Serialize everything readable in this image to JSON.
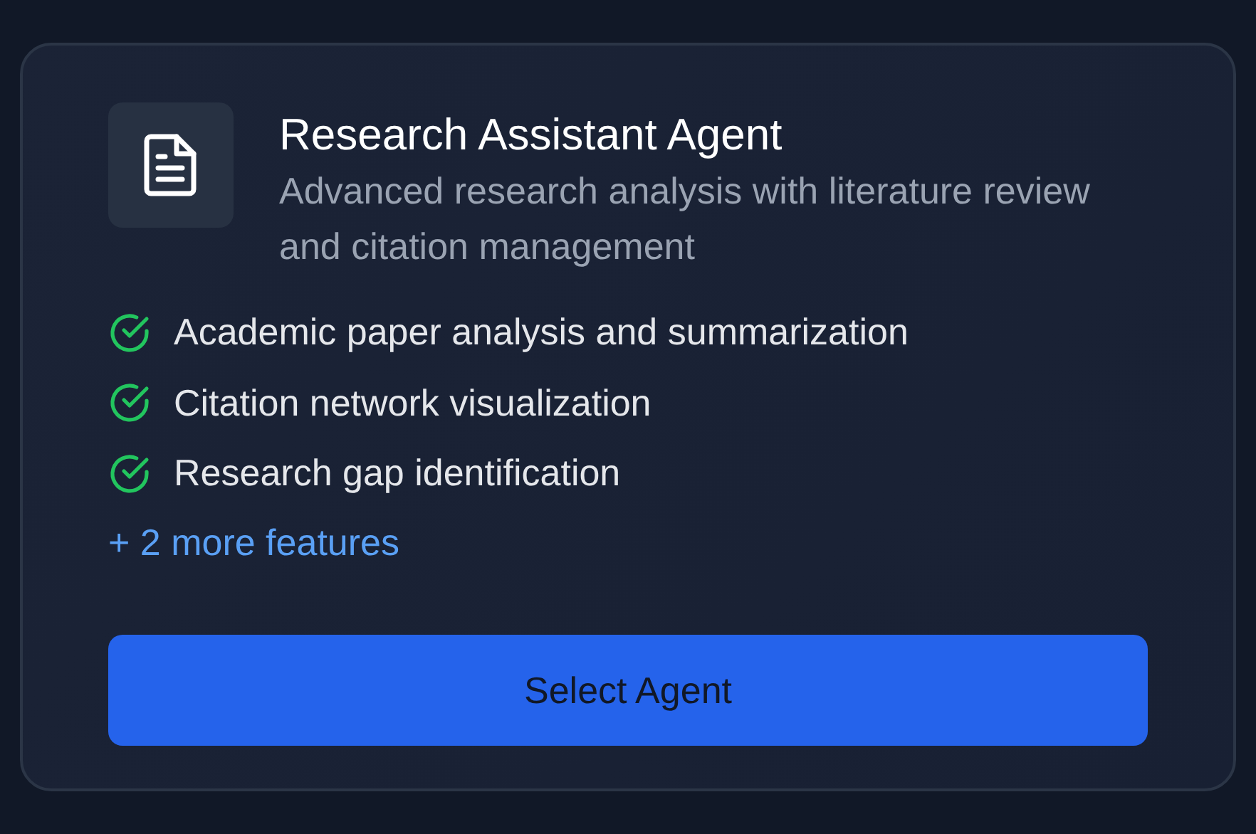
{
  "card": {
    "title": "Research Assistant Agent",
    "description": "Advanced research analysis with literature review and citation management",
    "features": [
      {
        "label": "Academic paper analysis and summarization",
        "checked": true
      },
      {
        "label": "Citation network visualization",
        "checked": true
      },
      {
        "label": "Research gap identification",
        "checked": true
      }
    ],
    "more_link": "+ 2 more features",
    "button": "Select Agent"
  }
}
